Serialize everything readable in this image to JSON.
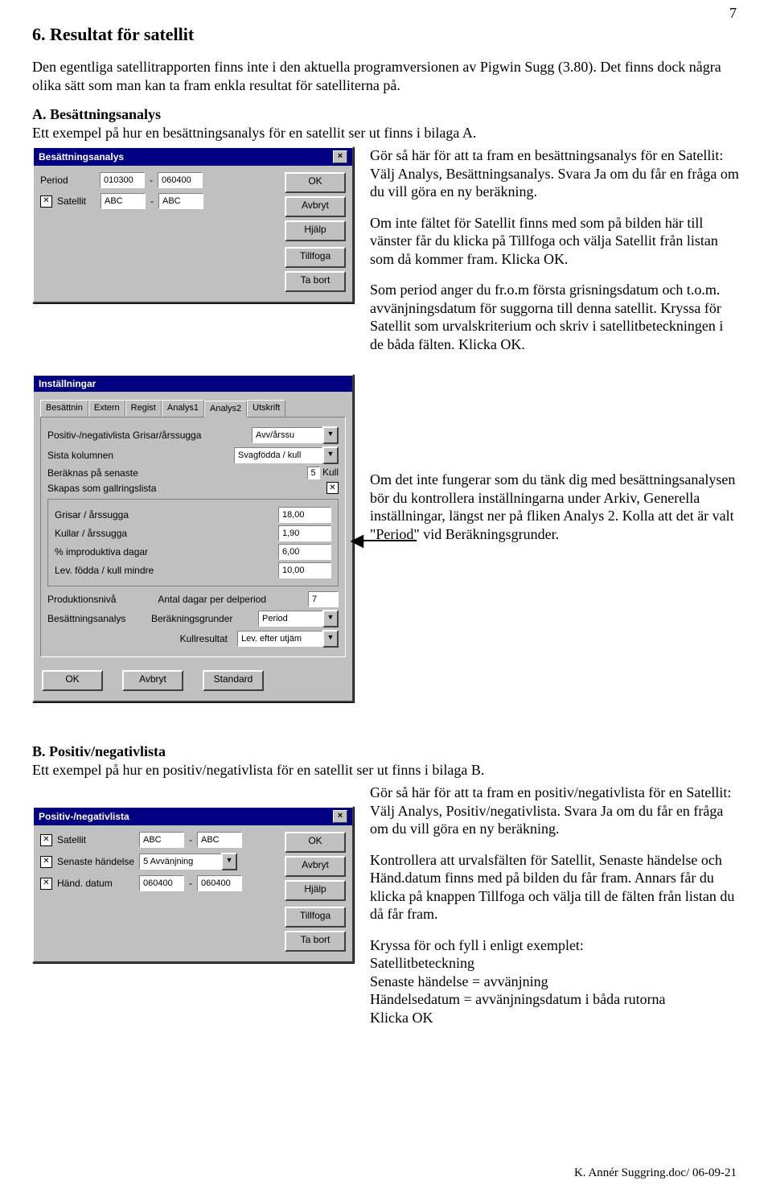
{
  "page_number": "7",
  "h1": "6. Resultat för satellit",
  "intro": "Den egentliga satellitrapporten finns inte i den aktuella programversionen av Pigwin Sugg (3.80). Det finns dock några olika sätt som man kan ta fram enkla resultat för satelliterna på.",
  "secA": {
    "heading": "A. Besättningsanalys",
    "line": "Ett exempel på hur en besättningsanalys för en satellit ser ut finns i bilaga A."
  },
  "dlg1": {
    "title": "Besättningsanalys",
    "period_lbl": "Period",
    "period_from": "010300",
    "period_to": "060400",
    "sat_lbl": "Satellit",
    "sat_from": "ABC",
    "sat_to": "ABC",
    "btn_ok": "OK",
    "btn_cancel": "Avbryt",
    "btn_help": "Hjälp",
    "btn_add": "Tillfoga",
    "btn_del": "Ta bort",
    "dash": "-"
  },
  "textA1": "Gör så här för att ta fram en besättningsanalys för en Satellit:\nVälj Analys, Besättningsanalys. Svara Ja om du får en fråga om du vill göra en ny beräkning.",
  "textA2": "Om inte fältet för Satellit finns med som på bilden här till vänster får du klicka på Tillfoga och välja Satellit från listan som då kommer fram. Klicka OK.",
  "textA3": "Som period anger du fr.o.m första grisningsdatum och t.o.m. avvänjningsdatum för suggorna till denna satellit. Kryssa för Satellit som urvalskriterium och skriv i satellitbeteckningen i de båda fälten. Klicka OK.",
  "dlg2": {
    "title": "Inställningar",
    "tabs": [
      "Besättnin",
      "Extern",
      "Regist",
      "Analys1",
      "Analys2",
      "Utskrift"
    ],
    "rows": {
      "posneg_lbl": "Positiv-/negativlista  Grisar/årssugga",
      "posneg_val": "Avv/årssu",
      "sistakol_lbl": "Sista kolumnen",
      "sistakol_val": "Svagfödda / kull",
      "beraknas_lbl": "Beräknas på senaste",
      "beraknas_val": "5",
      "beraknas_unit": "Kull",
      "skapas_lbl": "Skapas som gallringslista"
    },
    "grp": {
      "g_per_sugg": "Grisar / årssugga",
      "g_per_sugg_v": "18,00",
      "kull_sugg": "Kullar / årssugga",
      "kull_sugg_v": "1,90",
      "improd": "% improduktiva dagar",
      "improd_v": "6,00",
      "lev": "Lev. födda / kull mindre",
      "lev_v": "10,00"
    },
    "prodniva_lbl": "Produktionsnivå",
    "antal_lbl": "Antal dagar per delperiod",
    "antal_v": "7",
    "besan_lbl": "Besättningsanalys",
    "berak_lbl": "Beräkningsgrunder",
    "berak_v": "Period",
    "kullres_lbl": "Kullresultat",
    "kullres_v": "Lev. efter utjäm",
    "btn_ok": "OK",
    "btn_cancel": "Avbryt",
    "btn_std": "Standard"
  },
  "textA4": "Om det inte fungerar som du tänk dig med besättningsanalysen bör du kontrollera inställningarna under Arkiv, Generella inställningar, längst ner på fliken Analys 2. Kolla att det är valt \"Period\" vid Beräkningsgrunder.",
  "secB": {
    "heading": "B. Positiv/negativlista",
    "line": "Ett exempel på hur en positiv/negativlista för en satellit ser ut finns i bilaga B."
  },
  "dlg3": {
    "title": "Positiv-/negativlista",
    "sat_lbl": "Satellit",
    "sat_from": "ABC",
    "sat_to": "ABC",
    "ev_lbl": "Senaste händelse",
    "ev_val": "5 Avvänjning",
    "dat_lbl": "Händ. datum",
    "dat_from": "060400",
    "dat_to": "060400",
    "btn_ok": "OK",
    "btn_cancel": "Avbryt",
    "btn_help": "Hjälp",
    "btn_add": "Tillfoga",
    "btn_del": "Ta bort",
    "dash": "-"
  },
  "textB1": "Gör så här för att ta fram en positiv/negativlista för en Satellit:\nVälj Analys, Positiv/negativlista. Svara Ja om du får en fråga om du vill göra en ny beräkning.",
  "textB2": "Kontrollera att urvalsfälten för Satellit, Senaste händelse och Händ.datum finns med på bilden du får fram. Annars får du klicka på knappen Tillfoga och välja till de fälten från listan du då får fram.",
  "textB3": "Kryssa för och fyll i enligt exemplet:\nSatellitbeteckning\nSenaste händelse = avvänjning\nHändelsedatum = avvänjningsdatum i båda rutorna\nKlicka OK",
  "footer": "K. Annér  Suggring.doc/  06-09-21"
}
